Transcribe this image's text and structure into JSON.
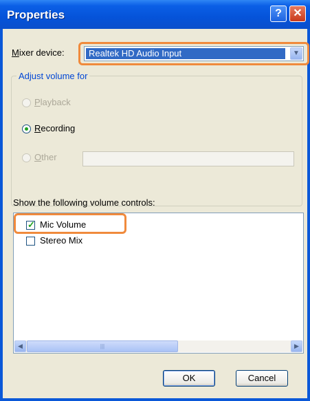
{
  "window": {
    "title": "Properties",
    "help_glyph": "?",
    "close_glyph": "✕"
  },
  "mixer": {
    "label_prefix": "M",
    "label_rest": "ixer device:",
    "selected": "Realtek HD Audio Input",
    "arrow": "▼"
  },
  "adjust": {
    "legend": "Adjust volume for",
    "options": [
      {
        "prefix": "P",
        "rest": "layback",
        "selected": false,
        "enabled": false
      },
      {
        "prefix": "R",
        "rest": "ecording",
        "selected": true,
        "enabled": true
      },
      {
        "prefix": "O",
        "rest": "ther",
        "selected": false,
        "enabled": false
      }
    ]
  },
  "controls": {
    "heading": "Show the following volume controls:",
    "items": [
      {
        "label": "Mic Volume",
        "checked": true
      },
      {
        "label": "Stereo Mix",
        "checked": false
      }
    ],
    "scroll_left": "◀",
    "scroll_right": "▶",
    "thumb_grip": "|||"
  },
  "buttons": {
    "ok": "OK",
    "cancel": "Cancel"
  },
  "colors": {
    "highlight": "#f08a3c",
    "titlebar": "#0553d9",
    "selection": "#316ac5"
  }
}
